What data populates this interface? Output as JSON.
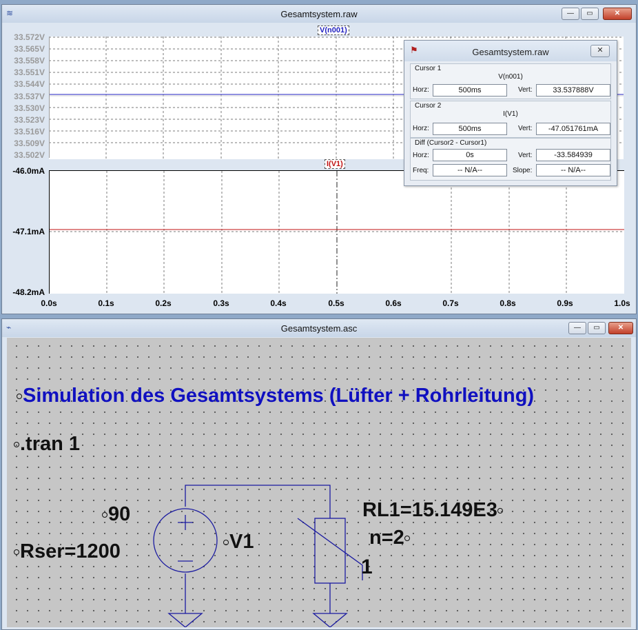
{
  "raw_window": {
    "title": "Gesamtsystem.raw",
    "buttons": {
      "minimize": "—",
      "maximize": "▭",
      "close": "✕"
    },
    "voltage_pane": {
      "trace_label": "V(n001)",
      "y_ticks": [
        "33.572V",
        "33.565V",
        "33.558V",
        "33.551V",
        "33.544V",
        "33.537V",
        "33.530V",
        "33.523V",
        "33.516V",
        "33.509V",
        "33.502V"
      ]
    },
    "current_pane": {
      "trace_label": "I(V1)",
      "y_ticks": [
        "-46.0mA",
        "-47.1mA",
        "-48.2mA"
      ]
    },
    "x_ticks": [
      "0.0s",
      "0.1s",
      "0.2s",
      "0.3s",
      "0.4s",
      "0.5s",
      "0.6s",
      "0.7s",
      "0.8s",
      "0.9s",
      "1.0s"
    ],
    "trace_colors": {
      "voltage": "#2020c0",
      "current": "#c01010"
    }
  },
  "cursor_dialog": {
    "title": "Gesamtsystem.raw",
    "close": "✕",
    "cursor1": {
      "label": "Cursor 1",
      "signal": "V(n001)",
      "horz_label": "Horz:",
      "horz": "500ms",
      "vert_label": "Vert:",
      "vert": "33.537888V"
    },
    "cursor2": {
      "label": "Cursor 2",
      "signal": "I(V1)",
      "horz_label": "Horz:",
      "horz": "500ms",
      "vert_label": "Vert:",
      "vert": "-47.051761mA"
    },
    "diff": {
      "label": "Diff (Cursor2 - Cursor1)",
      "horz_label": "Horz:",
      "horz": "0s",
      "vert_label": "Vert:",
      "vert": "-33.584939",
      "freq_label": "Freq:",
      "freq": "-- N/A--",
      "slope_label": "Slope:",
      "slope": "-- N/A--"
    }
  },
  "asc_window": {
    "title": "Gesamtsystem.asc",
    "buttons": {
      "minimize": "—",
      "maximize": "▭",
      "close": "✕"
    },
    "heading": "Simulation des Gesamtsystems (Lüfter + Rohrleitung)",
    "directive": ".tran 1",
    "source_value": "90",
    "source_name": "V1",
    "source_rser": "Rser=1200",
    "load_name": "RL1=15.149E3",
    "load_param": "n=2",
    "load_pin": "1",
    "heading_color": "#1010c0"
  }
}
